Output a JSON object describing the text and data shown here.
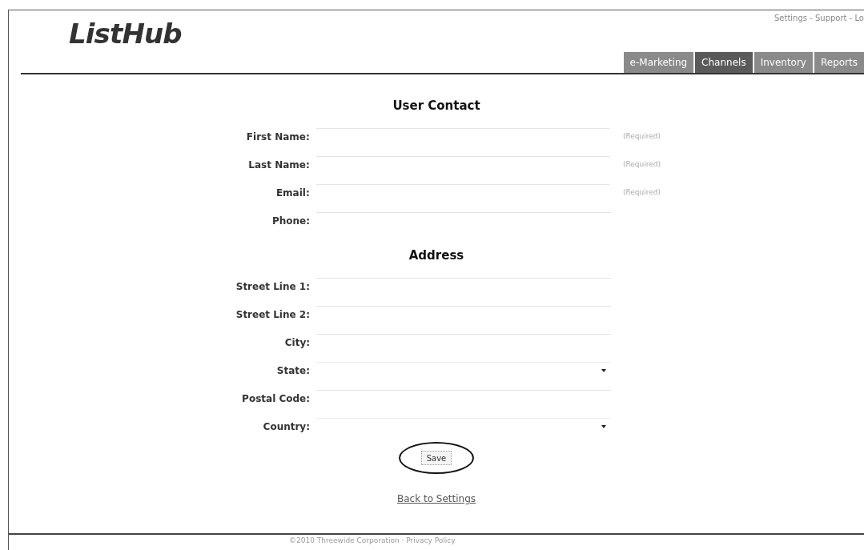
{
  "header": {
    "logo": "ListHub",
    "top_links": "Settings - Support - Lo"
  },
  "tabs": [
    {
      "label": "e-Marketing",
      "selected": false
    },
    {
      "label": "Channels",
      "selected": true
    },
    {
      "label": "Inventory",
      "selected": false
    },
    {
      "label": "Reports",
      "selected": false
    }
  ],
  "sections": [
    {
      "title": "User Contact",
      "fields": [
        {
          "label": "First Name:",
          "kind": "text",
          "note": "(Required)"
        },
        {
          "label": "Last Name:",
          "kind": "text",
          "note": "(Required)"
        },
        {
          "label": "Email:",
          "kind": "text",
          "note": "(Required)"
        },
        {
          "label": "Phone:",
          "kind": "text"
        }
      ]
    },
    {
      "title": "Address",
      "fields": [
        {
          "label": "Street Line 1:",
          "kind": "text"
        },
        {
          "label": "Street Line 2:",
          "kind": "text"
        },
        {
          "label": "City:",
          "kind": "text"
        },
        {
          "label": "State:",
          "kind": "select"
        },
        {
          "label": "Postal Code:",
          "kind": "text"
        },
        {
          "label": "Country:",
          "kind": "select"
        }
      ]
    }
  ],
  "save_button": "Save",
  "back_link": "Back to Settings",
  "footer": "©2010 Threewide Corporation · Privacy Policy"
}
